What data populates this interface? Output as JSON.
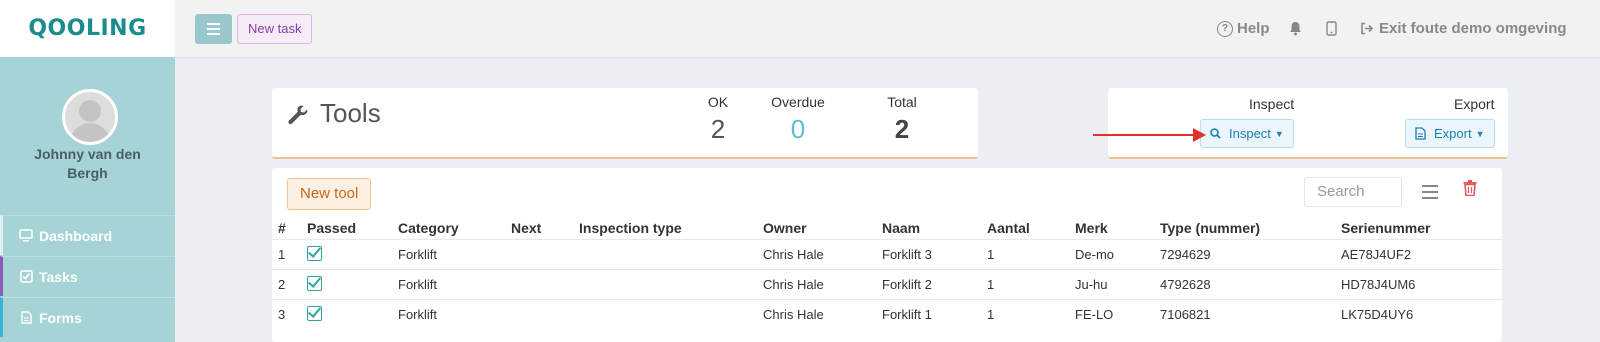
{
  "logo": "QOOLING",
  "user": {
    "name": "Johnny van den Bergh"
  },
  "sidebar": {
    "items": [
      {
        "label": "Dashboard",
        "icon": "monitor-icon"
      },
      {
        "label": "Tasks",
        "icon": "check-square-icon"
      },
      {
        "label": "Forms",
        "icon": "file-icon"
      }
    ]
  },
  "topbar": {
    "new_task": "New task",
    "help": "Help",
    "exit": "Exit foute demo omgeving"
  },
  "tools": {
    "title": "Tools",
    "ok_label": "OK",
    "ok_value": "2",
    "overdue_label": "Overdue",
    "overdue_value": "0",
    "total_label": "Total",
    "total_value": "2"
  },
  "actions": {
    "inspect_label": "Inspect",
    "inspect_button": "Inspect",
    "export_label": "Export",
    "export_button": "Export"
  },
  "table": {
    "new_tool": "New tool",
    "search_placeholder": "Search",
    "headers": [
      "#",
      "Passed",
      "Category",
      "Next",
      "Inspection type",
      "Owner",
      "Naam",
      "Aantal",
      "Merk",
      "Type (nummer)",
      "Serienummer"
    ],
    "rows": [
      {
        "n": "1",
        "passed": true,
        "category": "Forklift",
        "next": "",
        "inspection_type": "",
        "owner": "Chris Hale",
        "naam": "Forklift 3",
        "aantal": "1",
        "merk": "De-mo",
        "type": "7294629",
        "serie": "AE78J4UF2"
      },
      {
        "n": "2",
        "passed": true,
        "category": "Forklift",
        "next": "",
        "inspection_type": "",
        "owner": "Chris Hale",
        "naam": "Forklift 2",
        "aantal": "1",
        "merk": "Ju-hu",
        "type": "4792628",
        "serie": "HD78J4UM6"
      },
      {
        "n": "3",
        "passed": true,
        "category": "Forklift",
        "next": "",
        "inspection_type": "",
        "owner": "Chris Hale",
        "naam": "Forklift 1",
        "aantal": "1",
        "merk": "FE-LO",
        "type": "7106821",
        "serie": "LK75D4UY6"
      }
    ]
  },
  "colors": {
    "accent": "#1a8c8c",
    "sidebar": "#a5d3d6",
    "arrow": "#e23228",
    "overdue": "#5bc0cc"
  }
}
